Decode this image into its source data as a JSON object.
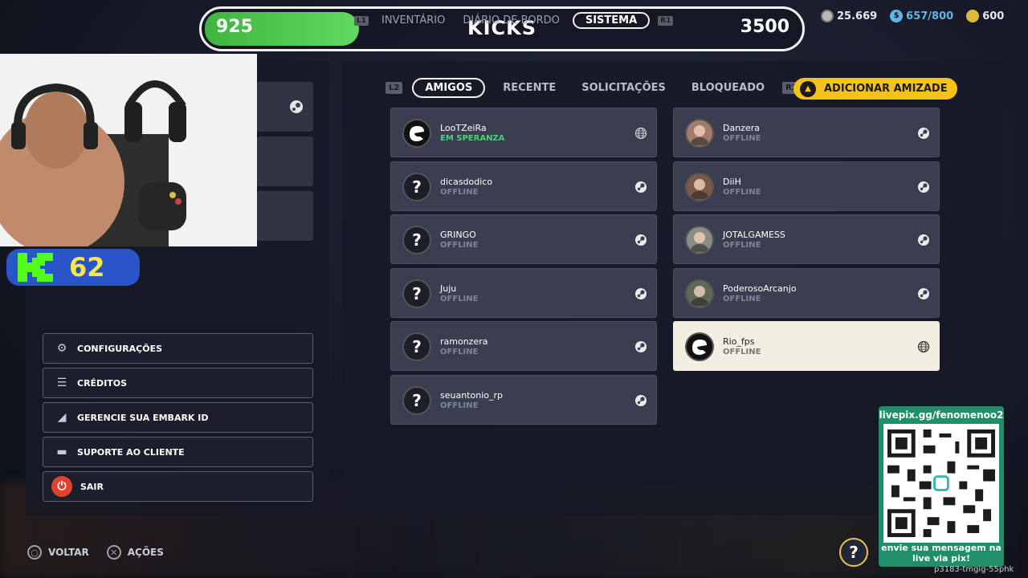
{
  "topbar": {
    "xp_current": "925",
    "xp_target": "3500",
    "xp_progress": 0.26,
    "title": "KICKS",
    "nav": [
      {
        "hint": "L1"
      },
      {
        "label": "INVENTÁRIO"
      },
      {
        "label": "DIÁRIO DE BORDO"
      },
      {
        "label": "SISTEMA",
        "active": true
      },
      {
        "hint": "R1"
      }
    ]
  },
  "currencies": [
    {
      "value": "25.669",
      "icon": "vres-coin-icon",
      "color": "#b9b9b9"
    },
    {
      "value": "657/800",
      "icon": "dollar-coin-icon",
      "color": "#5fb6e8"
    },
    {
      "value": "600",
      "icon": "multibucks-icon",
      "color": "#e0b93a"
    }
  ],
  "overlay": {
    "kick_count": "62"
  },
  "menu": [
    {
      "label": "CONFIGURAÇÕES",
      "icon": "gear-icon"
    },
    {
      "label": "CRÉDITOS",
      "icon": "credits-icon"
    },
    {
      "label": "GERENCIE SUA EMBARK ID",
      "icon": "embark-icon"
    },
    {
      "label": "SUPORTE AO CLIENTE",
      "icon": "support-icon"
    },
    {
      "label": "SAIR",
      "icon": "power-icon"
    }
  ],
  "tabs": {
    "left_hint": "L2",
    "items": [
      "AMIGOS",
      "RECENTE",
      "SOLICITAÇÕES",
      "BLOQUEADO"
    ],
    "active": "AMIGOS",
    "right_hint": "R2",
    "add_friend": "ADICIONAR AMIZADE"
  },
  "friends_left": [
    {
      "name": "LooTZeiRa",
      "status": "EM SPERANZA",
      "avatar": "embark",
      "platform": "globe-icon",
      "online": true
    },
    {
      "name": "dicasdodico",
      "status": "OFFLINE",
      "avatar": "unknown",
      "platform": "steam-icon"
    },
    {
      "name": "GRINGO",
      "status": "OFFLINE",
      "avatar": "unknown",
      "platform": "steam-icon"
    },
    {
      "name": "Juju",
      "status": "OFFLINE",
      "avatar": "unknown",
      "platform": "steam-icon"
    },
    {
      "name": "ramonzera",
      "status": "OFFLINE",
      "avatar": "unknown",
      "platform": "steam-icon"
    },
    {
      "name": "seuantonio_rp",
      "status": "OFFLINE",
      "avatar": "unknown",
      "platform": "steam-icon"
    }
  ],
  "friends_right": [
    {
      "name": "Danzera",
      "status": "OFFLINE",
      "avatar": "photo",
      "platform": "steam-icon"
    },
    {
      "name": "DiiH",
      "status": "OFFLINE",
      "avatar": "photo",
      "platform": "steam-icon"
    },
    {
      "name": "JOTALGAMESS",
      "status": "OFFLINE",
      "avatar": "photo",
      "platform": "steam-icon"
    },
    {
      "name": "PoderosoArcanjo",
      "status": "OFFLINE",
      "avatar": "photo",
      "platform": "steam-icon"
    },
    {
      "name": "Rio_fps",
      "status": "OFFLINE",
      "avatar": "embark",
      "platform": "globe-icon",
      "selected": true
    }
  ],
  "bottom": {
    "back": "VOLTAR",
    "actions": "AÇÕES"
  },
  "livepix": {
    "url": "livepix.gg/fenomenoo2",
    "message": "envie sua mensagem na live via pix!",
    "code": "p3183-tmgig-55phk"
  }
}
